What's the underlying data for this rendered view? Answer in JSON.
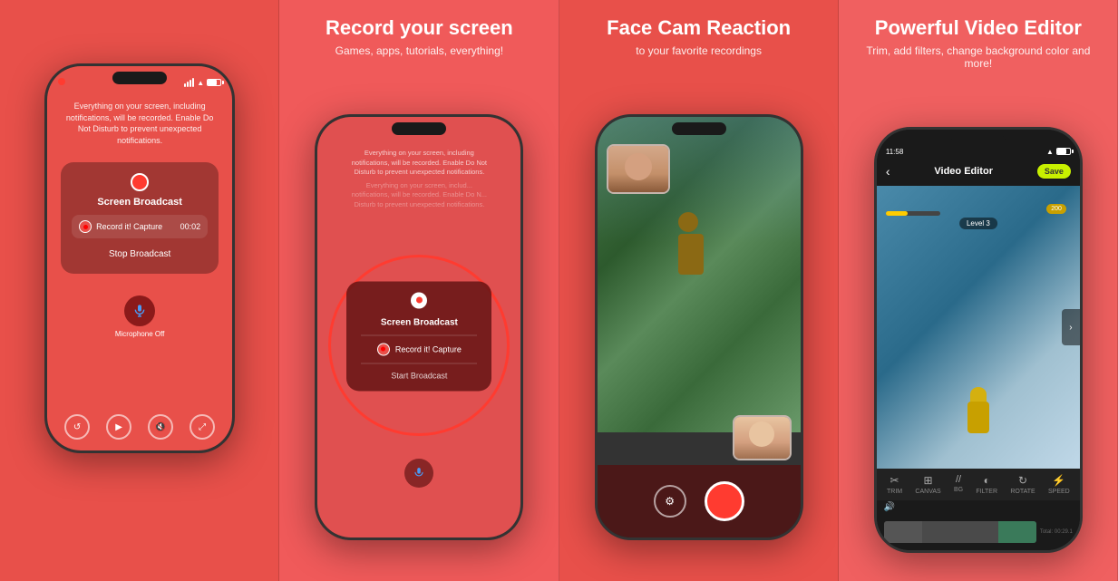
{
  "panel1": {
    "background": "#e8504a",
    "phone": {
      "info_text": "Everything on your screen, including notifications, will be recorded. Enable Do Not Disturb to prevent unexpected notifications.",
      "screen_broadcast_label": "Screen Broadcast",
      "record_capture_label": "Record it! Capture",
      "timer": "00:02",
      "stop_broadcast_label": "Stop Broadcast",
      "mic_label": "Microphone\nOff"
    }
  },
  "panel2": {
    "background": "#f05a5a",
    "title": "Record your screen",
    "subtitle": "Games, apps, tutorials, everything!",
    "menu": {
      "screen_broadcast": "Screen Broadcast",
      "record_capture": "Record it! Capture",
      "start_broadcast": "Start Broadcast"
    }
  },
  "panel3": {
    "background": "#e8504a",
    "title": "Face Cam Reaction",
    "subtitle": "to your favorite recordings"
  },
  "panel4": {
    "background": "#f06060",
    "title": "Powerful Video Editor",
    "subtitle": "Trim, add filters, change background color and more!",
    "editor": {
      "time": "11:58",
      "title": "Video Editor",
      "save_label": "Save",
      "level": "Level 3",
      "coins": "200",
      "tools": [
        {
          "icon": "✂",
          "label": "TRIM"
        },
        {
          "icon": "⊞",
          "label": "CANVAS"
        },
        {
          "icon": "//",
          "label": "BG"
        },
        {
          "icon": "◐",
          "label": "FILTER"
        },
        {
          "icon": "↻",
          "label": "ROTATE"
        },
        {
          "icon": "⚡",
          "label": "SPEED"
        }
      ]
    }
  }
}
